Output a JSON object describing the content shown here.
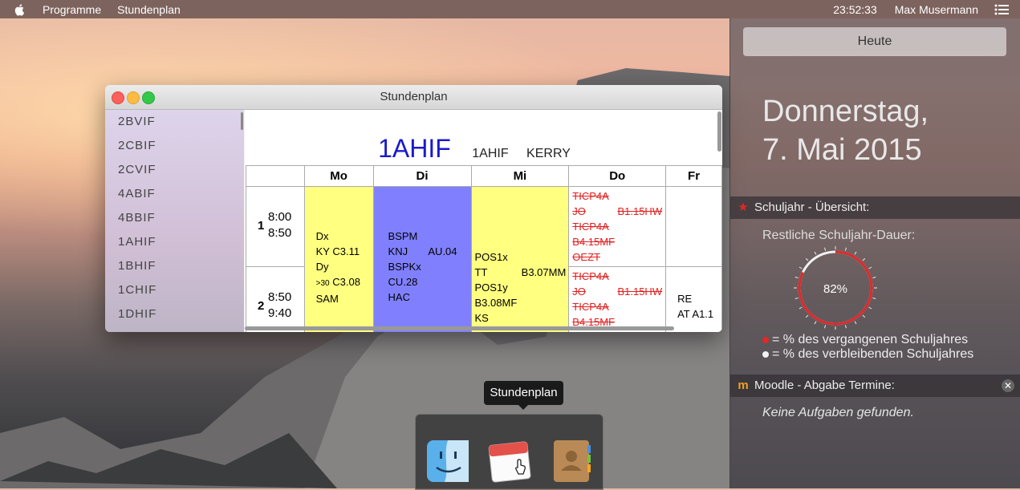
{
  "menubar": {
    "app_menu": "Programme",
    "window_menu": "Stundenplan",
    "clock": "23:52:33",
    "user": "Max Musermann"
  },
  "window": {
    "title": "Stundenplan",
    "sidebar": [
      "2BVIF",
      "2CBIF",
      "2CVIF",
      "4ABIF",
      "4BBIF",
      "1AHIF",
      "1BHIF",
      "1CHIF",
      "1DHIF"
    ],
    "header": {
      "class_name": "1AHIF",
      "class_short": "1AHIF",
      "teacher": "KERRY"
    },
    "days": [
      "Mo",
      "Di",
      "Mi",
      "Do",
      "Fr"
    ],
    "hours": [
      {
        "number": "1",
        "start": "8:00",
        "end": "8:50"
      },
      {
        "number": "2",
        "start": "8:50",
        "end": "9:40"
      }
    ],
    "mo": [
      "Dx",
      "KY C3.11",
      "Dy",
      ">30",
      "C3.08",
      "SAM"
    ],
    "di": [
      "BSPM",
      "KNJ",
      "AU.04",
      "BSPKx",
      "CU.28",
      "HAC"
    ],
    "mi": [
      "POS1x",
      "TT",
      "B3.07MM",
      "POS1y",
      "B3.08MF",
      "KS"
    ],
    "do_h1": [
      "TICP4A",
      "JO",
      "B1.15HW",
      "TICP4A",
      "B4.15MF",
      "OEZT"
    ],
    "do_h2": [
      "TICP4A",
      "JO",
      "B1.15HW",
      "TICP4A",
      "B4.15MF"
    ],
    "fr_h2": [
      "RE",
      "AT A1.1"
    ]
  },
  "panel": {
    "today_button": "Heute",
    "weekday": "Donnerstag,",
    "date": "7. Mai 2015",
    "schoolyear_title": "Schuljahr - Übersicht:",
    "remaining_label": "Restliche Schuljahr-Dauer:",
    "progress_label": "82%",
    "progress_fraction": 0.82,
    "legend_past": "= % des vergangenen Schuljahres",
    "legend_remaining": "= % des verbleibenden Schuljahres",
    "moodle_title": "Moodle - Abgabe Termine:",
    "moodle_empty": "Keine Aufgaben gefunden."
  },
  "dock": {
    "tooltip": "Stundenplan",
    "apps": [
      "finder-icon",
      "calendar-icon",
      "contacts-icon"
    ]
  },
  "colors": {
    "class_title": "#1a1acc",
    "mo_mi_cell": "#ffff80",
    "di_cell": "#8080ff",
    "cancelled": "#e02020",
    "progress_red": "#e02828"
  }
}
